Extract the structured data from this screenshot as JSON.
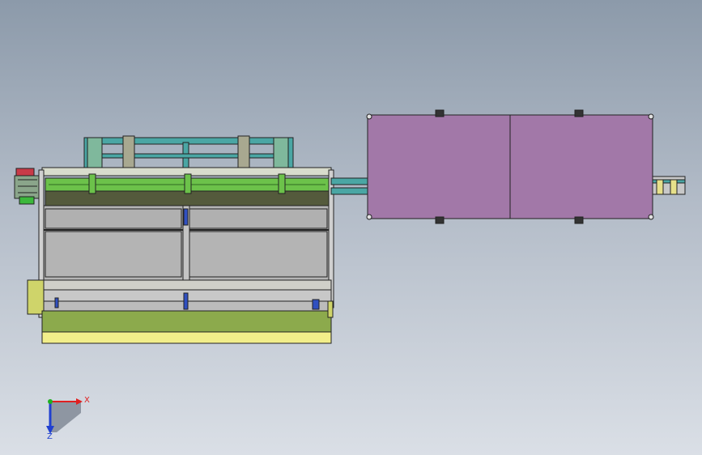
{
  "viewport": {
    "background_top": "#8c9aaa",
    "background_bottom": "#dadfe6"
  },
  "model": {
    "colors": {
      "frame_cyan": "#4aa6a4",
      "conveyor_green": "#6cc24a",
      "base_olive": "#8caa4c",
      "base_yellow": "#f2ee8a",
      "panel_grey": "#b4b4b4",
      "enclosure_purple": "#a278a8",
      "motor_yellow": "#cfd46a",
      "motor_red": "#c83b48",
      "edge_black": "#222222"
    }
  },
  "triad": {
    "x_label": "X",
    "z_label": "Z",
    "x_color": "#e02020",
    "y_color": "#20b020",
    "z_color": "#2040d0",
    "shadow_color": "#8e96a2"
  }
}
